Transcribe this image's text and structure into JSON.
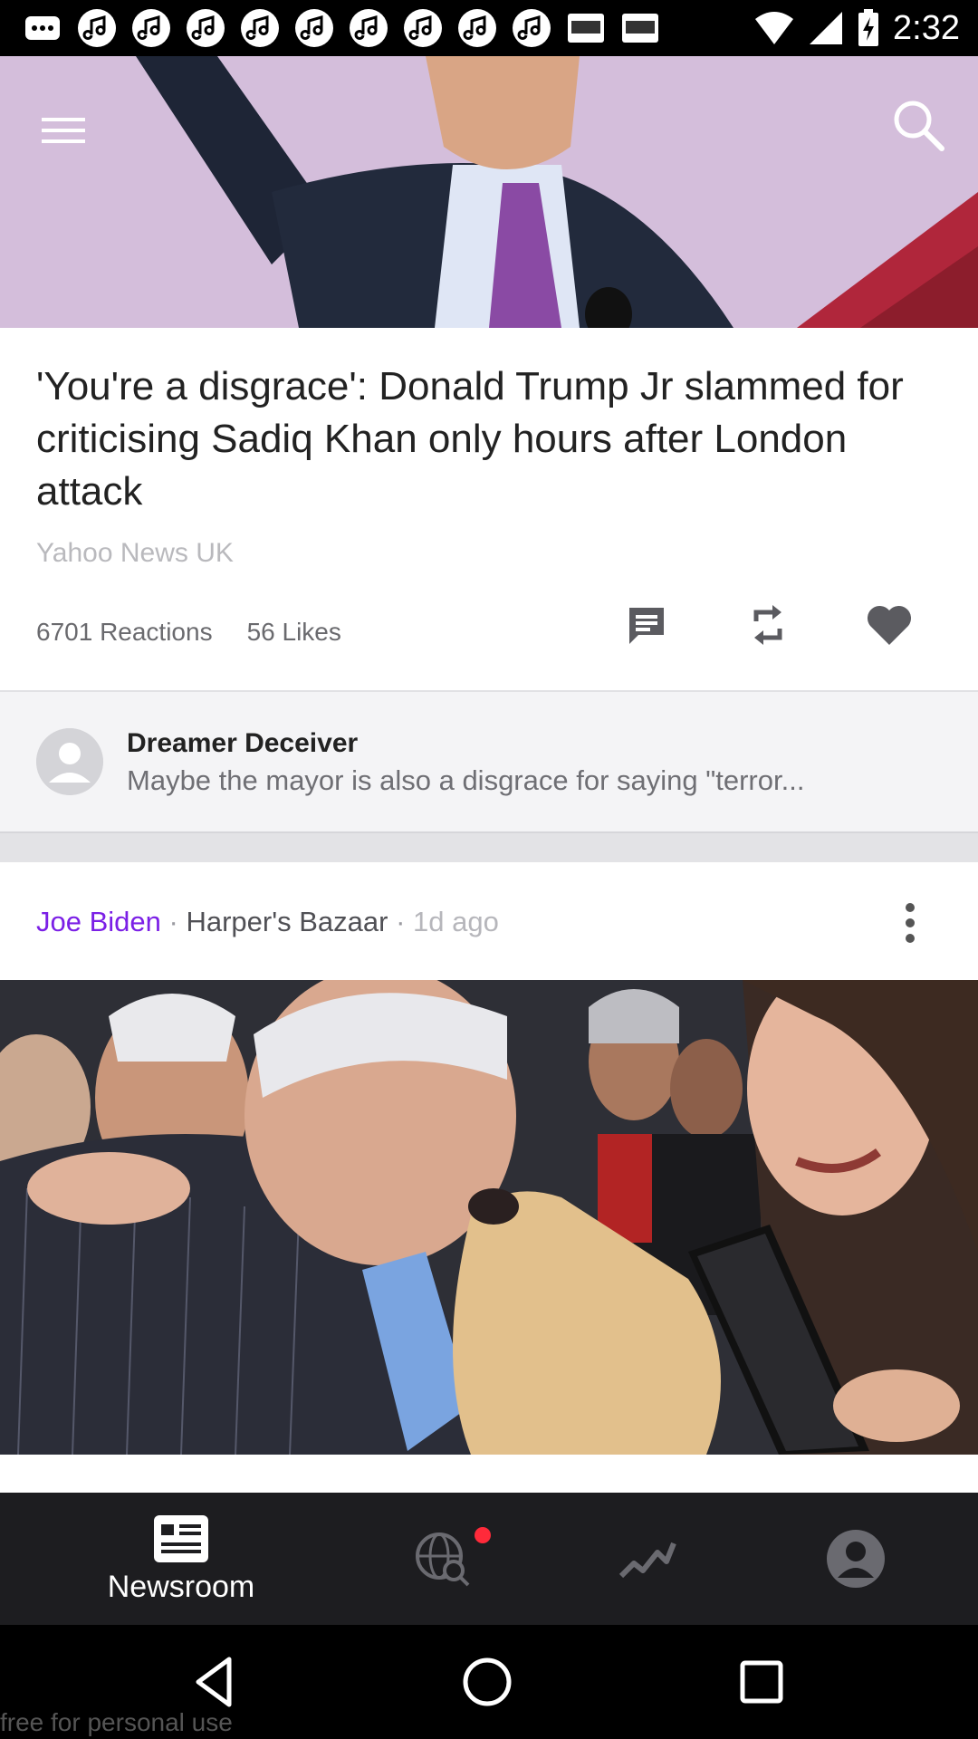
{
  "status_bar": {
    "time": "2:32",
    "notification_icons": [
      "chat-icon",
      "music-icon",
      "music-icon",
      "music-icon",
      "music-icon",
      "music-icon",
      "music-icon",
      "music-icon",
      "music-icon",
      "music-icon",
      "cnn-icon",
      "cnn-icon"
    ],
    "status_icons": [
      "wifi-icon",
      "signal-icon",
      "battery-charging-icon"
    ]
  },
  "header": {
    "menu_icon": "hamburger-menu-icon",
    "search_icon": "search-icon"
  },
  "article": {
    "headline": "'You're a disgrace': Donald Trump Jr slammed for criticising Sadiq Khan only hours after London attack",
    "source": "Yahoo News UK",
    "reactions": "6701 Reactions",
    "likes": "56 Likes"
  },
  "comment": {
    "author": "Dreamer Deceiver",
    "text": "Maybe the mayor is also a disgrace for saying \"terror..."
  },
  "card2": {
    "author": "Joe Biden",
    "publication": "Harper's Bazaar",
    "sep": " · ",
    "time": "1d ago"
  },
  "tabbar": {
    "newsroom_label": "Newsroom"
  },
  "colors": {
    "accent_purple": "#7b1fe6",
    "tabbar_bg": "#1d1d20",
    "badge_red": "#ff2a3a"
  },
  "watermark": "free for personal use"
}
